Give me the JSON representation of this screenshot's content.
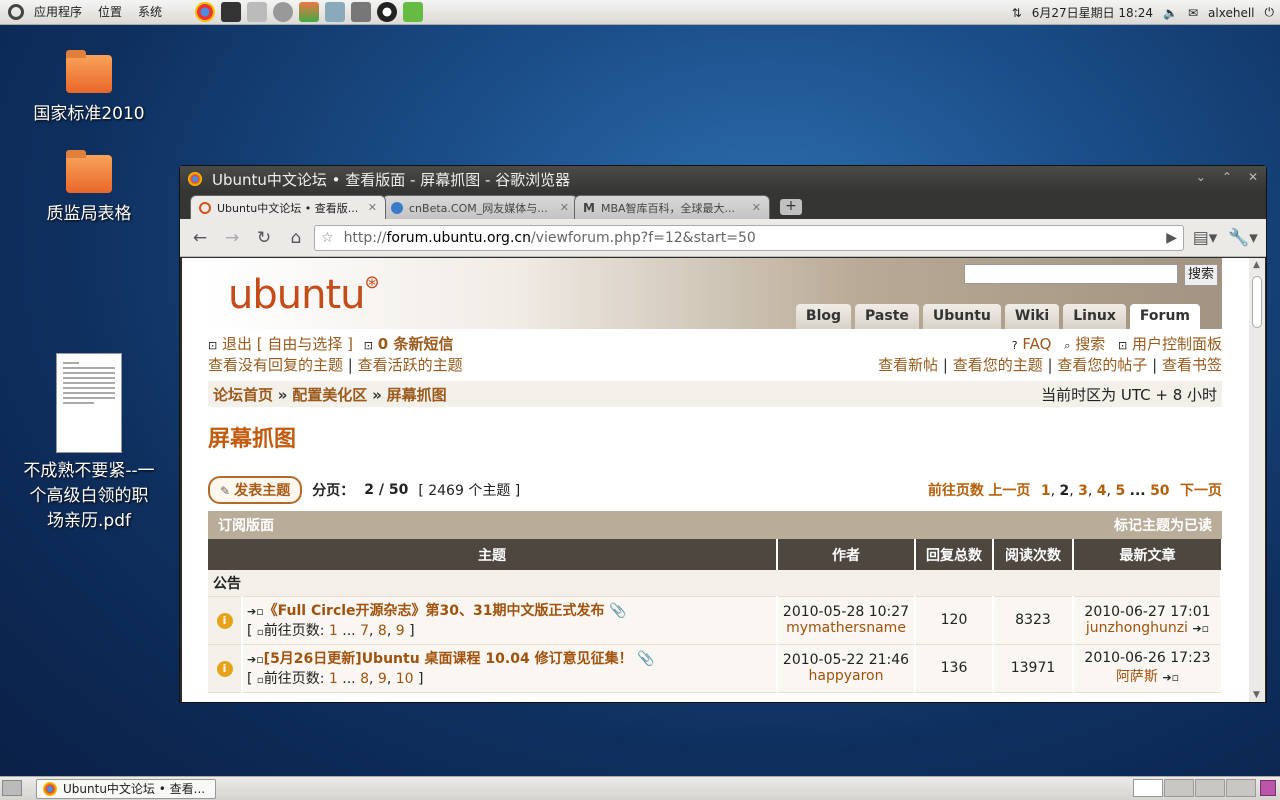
{
  "panel": {
    "menu": [
      "应用程序",
      "位置",
      "系统"
    ],
    "datetime": "6月27日星期日 18:24",
    "user": "alxehell"
  },
  "desktop": {
    "icons": [
      {
        "label": "国家标准2010"
      },
      {
        "label": "质监局表格"
      },
      {
        "label": "不成熟不要紧--一个高级白领的职场亲历.pdf"
      }
    ]
  },
  "browser": {
    "window_title": "Ubuntu中文论坛 • 查看版面 - 屏幕抓图 - 谷歌浏览器",
    "tabs": [
      {
        "label": "Ubuntu中文论坛 • 查看版..."
      },
      {
        "label": "cnBeta.COM_网友媒体与..."
      },
      {
        "label": "MBA智库百科，全球最大..."
      }
    ],
    "url_prefix": "http://",
    "url_host": "forum.ubuntu.org.cn",
    "url_path": "/viewforum.php?f=12&start=50"
  },
  "forum": {
    "logo": "ubuntu",
    "search_button": "搜索",
    "nav_tabs": [
      "Blog",
      "Paste",
      "Ubuntu",
      "Wiki",
      "Linux",
      "Forum"
    ],
    "logout": "退出 [ 自由与选择 ]",
    "new_pm": "0 条新短信",
    "faq": "FAQ",
    "search": "搜索",
    "ucp": "用户控制面板",
    "unanswered": "查看没有回复的主题",
    "active": "查看活跃的主题",
    "sep": "|",
    "view_new": "查看新帖",
    "your_topics": "查看您的主题",
    "your_posts": "查看您的帖子",
    "bookmarks": "查看书签",
    "crumbs": [
      "论坛首页",
      "配置美化区",
      "屏幕抓图"
    ],
    "crumb_sep": "»",
    "timezone": "当前时区为 UTC + 8 小时",
    "title": "屏幕抓图",
    "post_button": "发表主题",
    "page_label": "分页：",
    "page_value": "2 / 50",
    "topic_count": "[ 2469 个主题 ]",
    "goto": "前往页数",
    "prev": "上一页",
    "pages": [
      "1",
      "2",
      "3",
      "4",
      "5",
      "...",
      "50"
    ],
    "next": "下一页",
    "subscribe": "订阅版面",
    "mark_read": "标记主题为已读",
    "columns": [
      "主题",
      "作者",
      "回复总数",
      "阅读次数",
      "最新文章"
    ],
    "section": "公告",
    "topics": [
      {
        "title": "《Full Circle开源杂志》第30、31期中文版正式发布",
        "pager_label": "前往页数:",
        "pages": [
          "1",
          "...",
          "7",
          "8",
          "9"
        ],
        "date": "2010-05-28 10:27",
        "author": "mymathersname",
        "replies": "120",
        "views": "8323",
        "last_date": "2010-06-27 17:01",
        "last_author": "junzhonghunzi"
      },
      {
        "title": "[5月26日更新]Ubuntu 桌面课程 10.04 修订意见征集！",
        "pager_label": "前往页数:",
        "pages": [
          "1",
          "...",
          "8",
          "9",
          "10"
        ],
        "date": "2010-05-22 21:46",
        "author": "happyaron",
        "replies": "136",
        "views": "13971",
        "last_date": "2010-06-26 17:23",
        "last_author": "阿萨斯"
      }
    ]
  },
  "taskbar": {
    "task": "Ubuntu中文论坛 • 查看..."
  }
}
